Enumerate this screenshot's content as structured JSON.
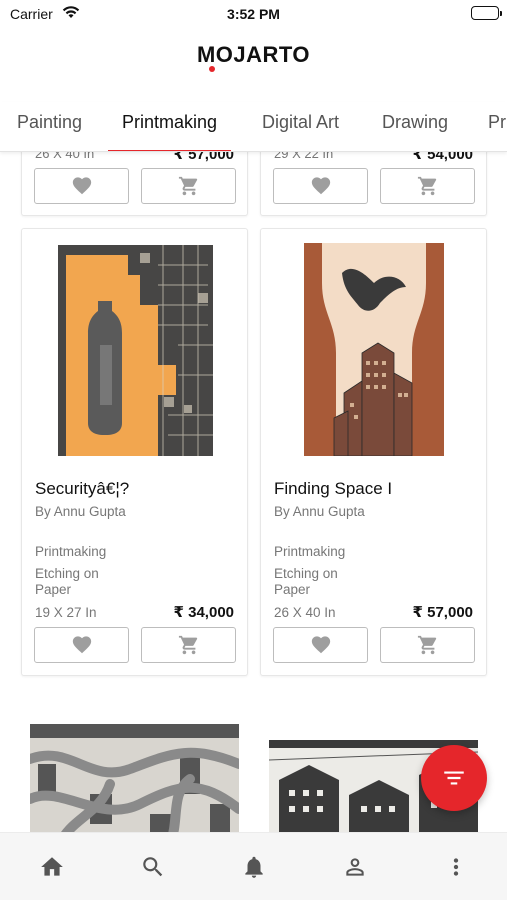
{
  "status_bar": {
    "carrier": "Carrier",
    "time": "3:52 PM"
  },
  "header": {
    "logo": "MOJARTO"
  },
  "tabs": [
    {
      "label": "Painting",
      "active": false
    },
    {
      "label": "Printmaking",
      "active": true
    },
    {
      "label": "Digital Art",
      "active": false
    },
    {
      "label": "Drawing",
      "active": false
    },
    {
      "label": "Pr",
      "active": false
    }
  ],
  "cards_top_partial": [
    {
      "size": "26 X 40 In",
      "price": "₹ 57,000"
    },
    {
      "size": "29 X 22 In",
      "price": "₹ 54,000"
    }
  ],
  "cards": [
    {
      "title": "Securityâ€¦?",
      "artist": "By Annu Gupta",
      "medium": "Printmaking",
      "technique": "Etching on Paper",
      "size": "19 X 27 In",
      "price": "₹ 34,000"
    },
    {
      "title": "Finding Space I",
      "artist": "By Annu Gupta",
      "medium": "Printmaking",
      "technique": "Etching on Paper",
      "size": "26 X 40 In",
      "price": "₹ 57,000"
    }
  ],
  "icons": {
    "wishlist": "heart-icon",
    "cart": "cart-icon",
    "filter": "filter-icon",
    "nav": [
      "home-icon",
      "search-icon",
      "bell-icon",
      "person-icon",
      "more-vertical-icon"
    ]
  },
  "colors": {
    "accent": "#e5262b",
    "text": "#111111",
    "muted": "#777777"
  }
}
